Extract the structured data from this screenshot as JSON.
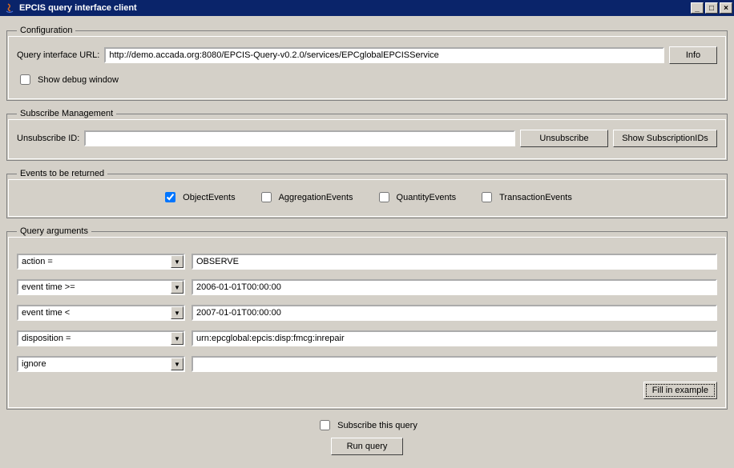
{
  "window": {
    "title": "EPCIS query interface client"
  },
  "config": {
    "legend": "Configuration",
    "url_label": "Query interface URL:",
    "url_value": "http://demo.accada.org:8080/EPCIS-Query-v0.2.0/services/EPCglobalEPCISService",
    "info_button": "Info",
    "debug_checkbox": "Show debug window",
    "debug_checked": false
  },
  "subscribe": {
    "legend": "Subscribe Management",
    "unsubscribe_label": "Unsubscribe ID:",
    "unsubscribe_value": "",
    "unsubscribe_button": "Unsubscribe",
    "show_ids_button": "Show SubscriptionIDs"
  },
  "events": {
    "legend": "Events to be returned",
    "object": {
      "label": "ObjectEvents",
      "checked": true
    },
    "aggregation": {
      "label": "AggregationEvents",
      "checked": false
    },
    "quantity": {
      "label": "QuantityEvents",
      "checked": false
    },
    "transaction": {
      "label": "TransactionEvents",
      "checked": false
    }
  },
  "query_args": {
    "legend": "Query arguments",
    "rows": [
      {
        "param": "action =",
        "value": "OBSERVE"
      },
      {
        "param": "event time >=",
        "value": "2006-01-01T00:00:00"
      },
      {
        "param": "event time <",
        "value": "2007-01-01T00:00:00"
      },
      {
        "param": "disposition =",
        "value": "urn:epcglobal:epcis:disp:fmcg:inrepair"
      },
      {
        "param": "ignore",
        "value": ""
      }
    ],
    "fill_button": "Fill in example"
  },
  "footer": {
    "subscribe_checkbox": "Subscribe this query",
    "subscribe_checked": false,
    "run_button": "Run query"
  }
}
